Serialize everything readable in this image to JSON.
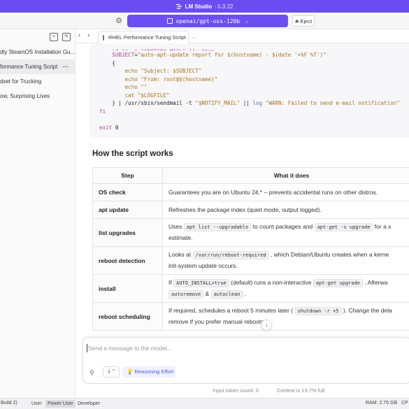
{
  "app": {
    "name": "LM Studio",
    "version": "- 0.3.22",
    "accent": "#6b4ff5"
  },
  "topbar": {
    "model": "openai/gpt-oss-120b",
    "eject_label": "Eject"
  },
  "sidebar": {
    "items": [
      {
        "label": "dly SteamOS Installation Gu..."
      },
      {
        "label": "formance Tuning Script",
        "active": true
      },
      {
        "label": "dset for Trucking"
      },
      {
        "label": "ow, Surprising Lives"
      }
    ]
  },
  "tab": {
    "label": "RHEL Performance Tuning Script"
  },
  "code": {
    "lines": [
      "    SUBJECT=\"auto-apt-update report for $(hostname) - $(date '+%F %T')\"",
      "    {",
      "        echo \"Subject: $SUBJECT\"",
      "        echo \"From: root@$(hostname)\"",
      "        echo \"\"",
      "        cat \"$LOGFILE\"",
      "    } | /usr/sbin/sendmail -t \"$NOTIFY_MAIL\" || log \"WARN: Failed to send e-mail notification\"",
      "fi",
      "",
      "exit 0"
    ]
  },
  "section": {
    "heading": "How the script works"
  },
  "table": {
    "headers": [
      "Step",
      "What it does"
    ],
    "rows": [
      {
        "step": "OS check",
        "desc": "Guarantees you are on Ubuntu 24.* – prevents accidental runs on other distros."
      },
      {
        "step": "apt update",
        "desc": "Refreshes the package index (quiet mode, output logged)."
      },
      {
        "step": "list upgrades",
        "d1": "Uses",
        "c1": "apt list --upgradable",
        "d2": "to count packages and",
        "c2": "apt-get -s upgrade",
        "d3": "for a s",
        "d4": "estimate."
      },
      {
        "step": "reboot detection",
        "d1": "Looks at",
        "c1": "/var/run/reboot-required",
        "d2": ", which Debian/Ubuntu creates when a kerne",
        "d3": "init-system update occurs."
      },
      {
        "step": "install",
        "d1": "If",
        "c1": "AUTO_INSTALL=true",
        "d2": "(default) runs a non-interactive",
        "c2": "apt-get upgrade",
        "d3": ". Afterwa",
        "c3": "autoremove",
        "d4": "&",
        "c4": "autoclean",
        "d5": "."
      },
      {
        "step": "reboot scheduling",
        "d1": "If required, schedules a reboot 5 minutes later (",
        "c1": "shutdown -r +5",
        "d2": "). Change the dela",
        "d3": "remove if you prefer manual reboots."
      }
    ]
  },
  "composer": {
    "placeholder": "Send a message to the model...",
    "effort_label": "Reasoning Effort"
  },
  "footer": {
    "input_tokens": "Input token count:  0",
    "context": "Context is 19.7% full"
  },
  "statusbar": {
    "build": "Build 2)",
    "user": "User",
    "power_user": "Power User",
    "developer": "Developer",
    "ram": "RAM: 2.75 GB",
    "cpu": "CP"
  }
}
